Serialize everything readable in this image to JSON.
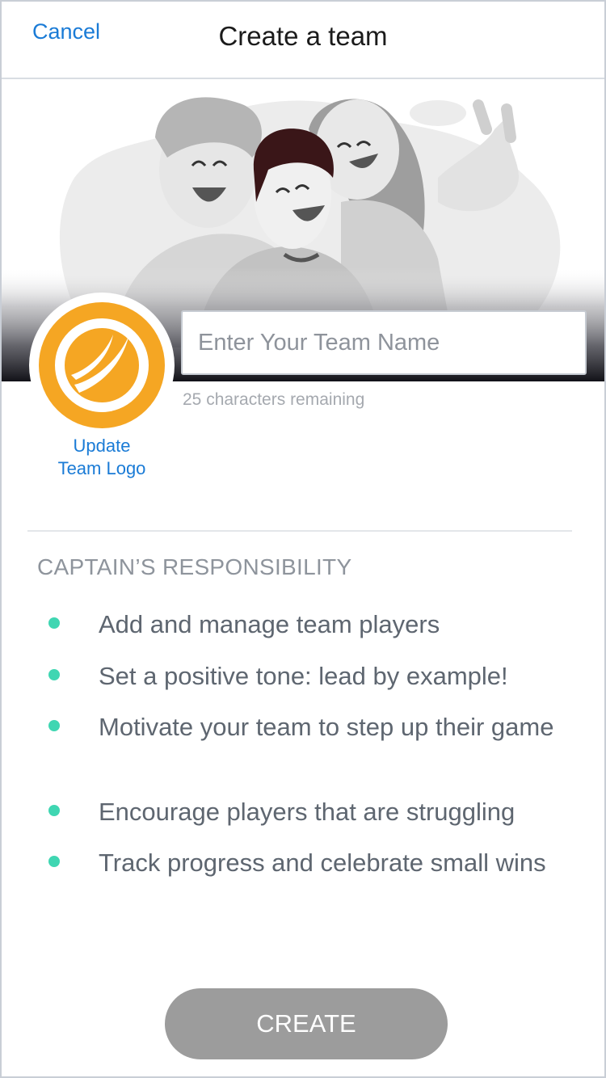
{
  "header": {
    "cancel_label": "Cancel",
    "title": "Create a team"
  },
  "hero": {
    "illustration": "three-friends-illustration"
  },
  "team_logo": {
    "icon": "team-logo-icon",
    "color": "#f5a623",
    "update_label_line1": "Update",
    "update_label_line2": "Team Logo"
  },
  "team_name": {
    "value": "",
    "placeholder": "Enter Your Team Name",
    "remaining_text": "25 characters remaining"
  },
  "responsibility": {
    "heading": "CAPTAIN’S RESPONSIBILITY",
    "items": [
      "Add and manage team players",
      "Set a positive tone: lead by example!",
      "Motivate your team to step up their game",
      "Encourage players that are struggling",
      "Track progress and celebrate small wins"
    ],
    "bullet_color": "#3fd6b2"
  },
  "footer": {
    "create_label": "CREATE",
    "create_color": "#9c9c9c"
  },
  "colors": {
    "link": "#1a7bd6",
    "text": "#5e6670"
  }
}
